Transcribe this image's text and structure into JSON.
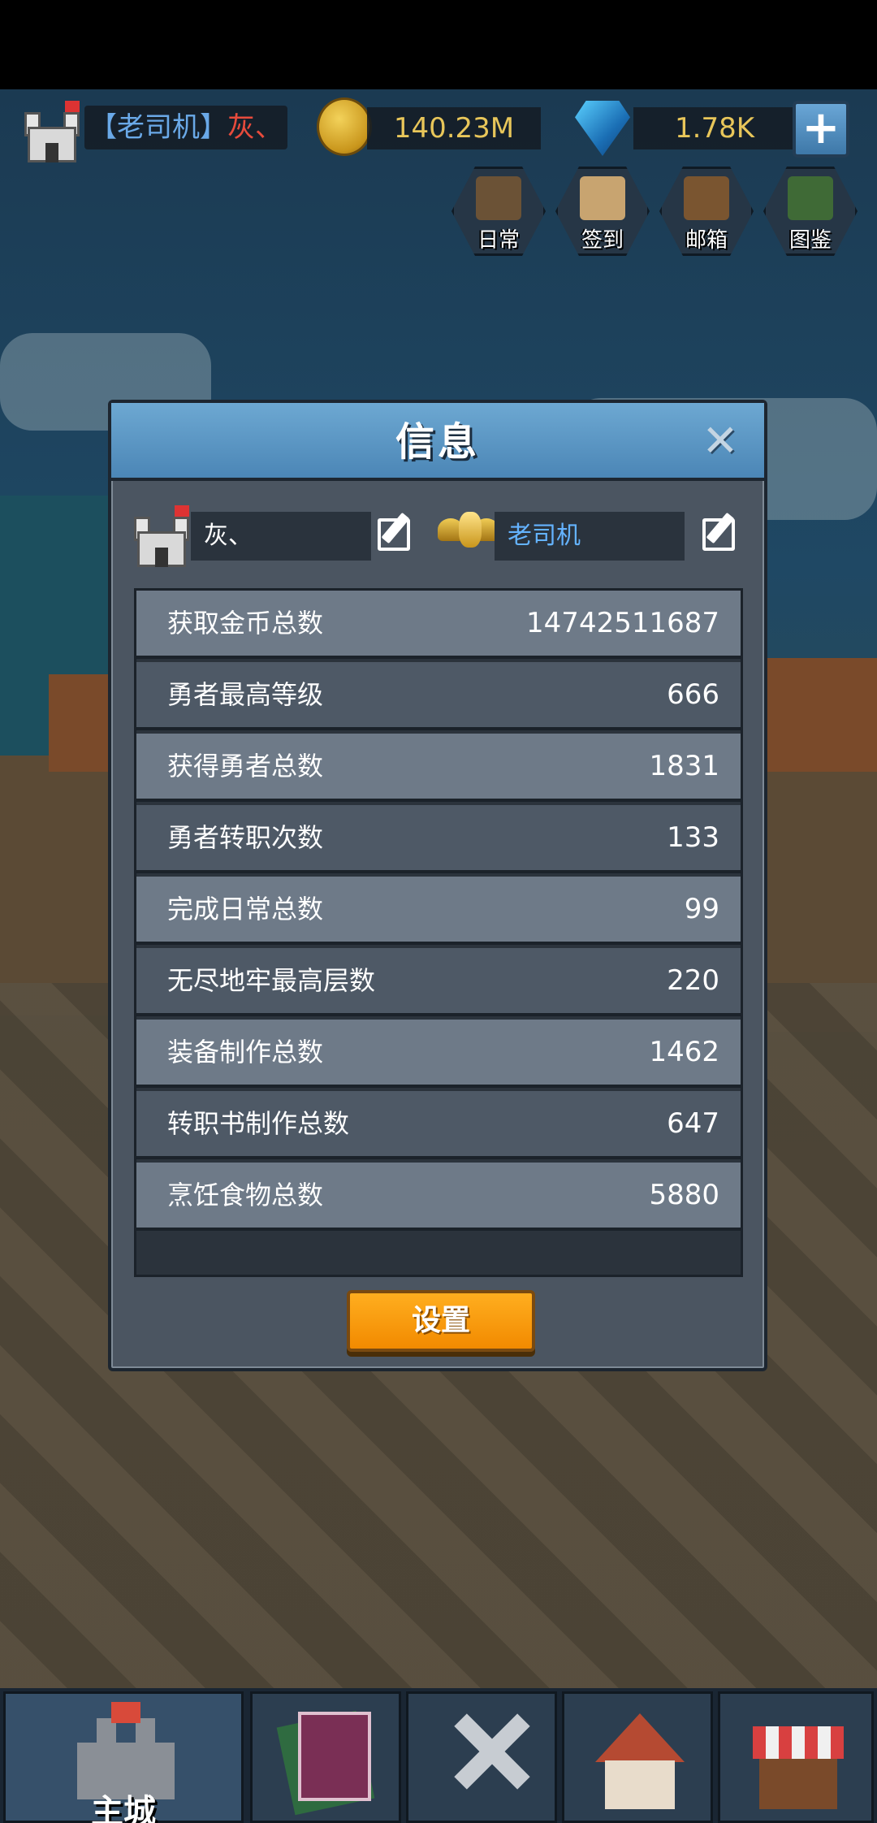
{
  "topbar": {
    "player_tag": "【老司机】",
    "player_name": "灰、",
    "gold": "140.23M",
    "gems": "1.78K",
    "plus_label": "+"
  },
  "quick_buttons": [
    {
      "label": "日常",
      "icon": "quill-scroll-icon"
    },
    {
      "label": "签到",
      "icon": "calendar-icon"
    },
    {
      "label": "邮箱",
      "icon": "mailbox-icon"
    },
    {
      "label": "图鉴",
      "icon": "book-icon"
    }
  ],
  "modal": {
    "title": "信息",
    "close": "✕",
    "player_name": "灰、",
    "guild_name": "老司机",
    "stats": [
      {
        "label": "获取金币总数",
        "value": "14742511687"
      },
      {
        "label": "勇者最高等级",
        "value": "666"
      },
      {
        "label": "获得勇者总数",
        "value": "1831"
      },
      {
        "label": "勇者转职次数",
        "value": "133"
      },
      {
        "label": "完成日常总数",
        "value": "99"
      },
      {
        "label": "无尽地牢最高层数",
        "value": "220"
      },
      {
        "label": "装备制作总数",
        "value": "1462"
      },
      {
        "label": "转职书制作总数",
        "value": "647"
      },
      {
        "label": "烹饪食物总数",
        "value": "5880"
      }
    ],
    "settings_button": "设置"
  },
  "bottom_nav": [
    {
      "label": "主城",
      "icon": "castle-icon",
      "active": true
    },
    {
      "label": "",
      "icon": "card-deck-icon",
      "active": false
    },
    {
      "label": "",
      "icon": "crossed-swords-icon",
      "active": false
    },
    {
      "label": "",
      "icon": "house-icon",
      "active": false
    },
    {
      "label": "",
      "icon": "shop-icon",
      "active": false
    }
  ],
  "colors": {
    "modal_header": "#5a96c4",
    "modal_body": "#4b5561",
    "settings_button": "#ff9f10",
    "guild_text": "#64b3ff",
    "player_tag": "#6aa9e8",
    "player_name_topbar": "#e84b3c",
    "currency_text": "#e8c65a"
  }
}
